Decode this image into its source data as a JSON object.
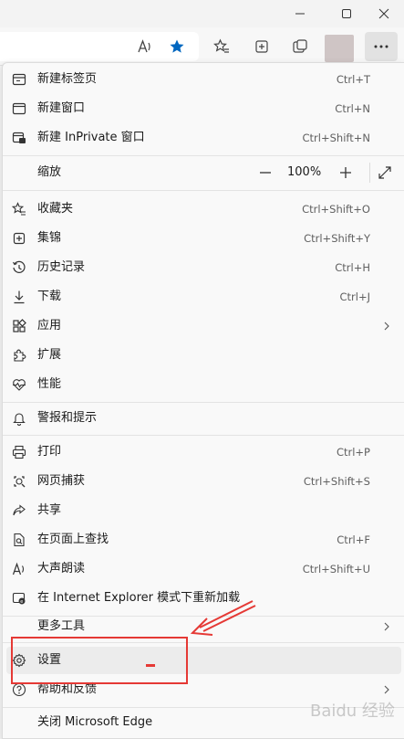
{
  "toolbar": {
    "address_value": ""
  },
  "menu": {
    "items": [
      {
        "label": "新建标签页",
        "shortcut": "Ctrl+T",
        "icon": "new-tab-icon"
      },
      {
        "label": "新建窗口",
        "shortcut": "Ctrl+N",
        "icon": "new-window-icon"
      },
      {
        "label": "新建 InPrivate 窗口",
        "shortcut": "Ctrl+Shift+N",
        "icon": "inprivate-icon"
      },
      {
        "label": "缩放",
        "icon": "none"
      },
      {
        "label": "收藏夹",
        "shortcut": "Ctrl+Shift+O",
        "icon": "favorites-icon"
      },
      {
        "label": "集锦",
        "shortcut": "Ctrl+Shift+Y",
        "icon": "collections-icon"
      },
      {
        "label": "历史记录",
        "shortcut": "Ctrl+H",
        "icon": "history-icon"
      },
      {
        "label": "下载",
        "shortcut": "Ctrl+J",
        "icon": "download-icon"
      },
      {
        "label": "应用",
        "icon": "apps-icon"
      },
      {
        "label": "扩展",
        "icon": "extensions-icon"
      },
      {
        "label": "性能",
        "icon": "performance-icon"
      },
      {
        "label": "警报和提示",
        "icon": "bell-icon"
      },
      {
        "label": "打印",
        "shortcut": "Ctrl+P",
        "icon": "print-icon"
      },
      {
        "label": "网页捕获",
        "shortcut": "Ctrl+Shift+S",
        "icon": "web-capture-icon"
      },
      {
        "label": "共享",
        "icon": "share-icon"
      },
      {
        "label": "在页面上查找",
        "shortcut": "Ctrl+F",
        "icon": "find-icon"
      },
      {
        "label": "大声朗读",
        "shortcut": "Ctrl+Shift+U",
        "icon": "read-aloud-icon"
      },
      {
        "label": "在 Internet Explorer 模式下重新加载",
        "icon": "ie-mode-icon"
      },
      {
        "label": "更多工具",
        "icon": "none"
      },
      {
        "label": "设置",
        "icon": "gear-icon"
      },
      {
        "label": "帮助和反馈",
        "icon": "help-icon"
      },
      {
        "label": "关闭 Microsoft Edge",
        "icon": "none"
      }
    ],
    "zoom_value": "100%"
  },
  "watermark": "Baidu 经验",
  "colors": {
    "accent": "#0067c0",
    "annotation": "#e53935",
    "menu_bg": "#f9f9f9"
  }
}
